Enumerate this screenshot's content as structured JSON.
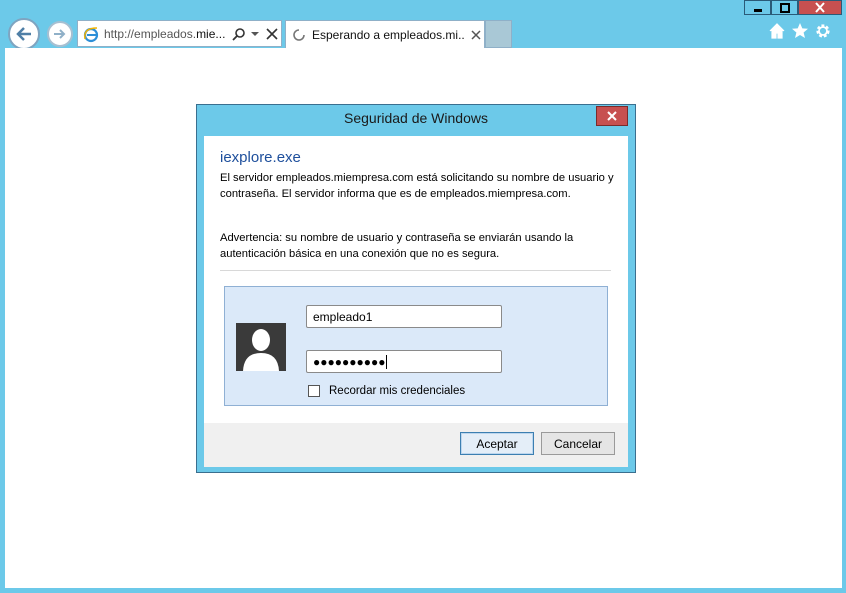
{
  "browser": {
    "address": {
      "prefix": "http://empleados.",
      "domain": "mie..."
    },
    "tab": {
      "title": "Esperando a empleados.mi..."
    }
  },
  "dialog": {
    "title": "Seguridad de Windows",
    "heading": "iexplore.exe",
    "message": "El servidor empleados.miempresa.com está solicitando su nombre de usuario y contraseña. El servidor informa que es de empleados.miempresa.com.",
    "warning": "Advertencia: su nombre de usuario y contraseña se enviarán usando la autenticación básica en una conexión que no es segura.",
    "username": "empleado1",
    "password_mask": "●●●●●●●●●●",
    "remember_label": "Recordar mis credenciales",
    "remember_checked": false,
    "ok_label": "Aceptar",
    "cancel_label": "Cancelar"
  },
  "colors": {
    "chrome": "#6cc9e9",
    "close": "#c75050",
    "heading": "#1e4f9c",
    "panel": "#dbe9f9"
  },
  "icons": [
    "back-icon",
    "forward-icon",
    "ie-logo-icon",
    "search-icon",
    "dropdown-icon",
    "stop-icon",
    "loading-icon",
    "home-icon",
    "favorites-star-icon",
    "settings-gear-icon",
    "minimize-icon",
    "maximize-icon",
    "close-icon",
    "user-avatar-icon"
  ]
}
